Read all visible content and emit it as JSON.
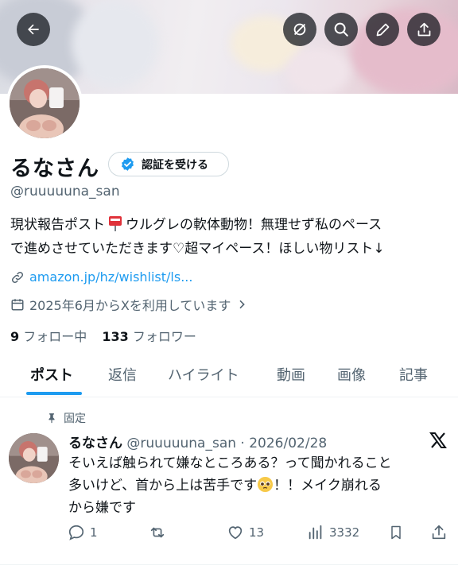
{
  "header": {
    "back_button": "back-arrow",
    "buttons": [
      "grok-icon",
      "search-icon",
      "edit-icon",
      "share-icon"
    ]
  },
  "profile": {
    "name": "るなさん",
    "verify_label": "認証を受ける",
    "handle": "@ruuuuuna_san",
    "bio_line1_pre": "現状報告ポスト",
    "bio_line1_post": "ウルグレの軟体動物！無理せず私のペース",
    "bio_line2": "で進めさせていただきます♡超マイペース！ほしい物リスト↓",
    "link_text": "amazon.jp/hz/wishlist/ls...",
    "joined_text": "2025年6月からXを利用しています",
    "following_count": "9",
    "following_label": " フォロー中",
    "followers_count": "133",
    "followers_label": " フォロワー"
  },
  "tabs": [
    "ポスト",
    "返信",
    "ハイライト",
    "動画",
    "画像",
    "記事"
  ],
  "active_tab": "ポスト",
  "pinned_post": {
    "pinned_label": "固定",
    "author_name": "るなさん",
    "meta": " @ruuuuuna_san · 2026/02/28",
    "text_line1": "そいえば触られて嫌なところある？って聞かれること",
    "text_line2_pre": "多いけど、首から上は苦手です",
    "text_line2_post": "！！メイク崩れる",
    "text_line3": "から嫌です",
    "replies": "1",
    "reposts": "",
    "likes": "13",
    "views": "3332"
  },
  "colors": {
    "accent": "#1d9bf0",
    "text_primary": "#0f1419",
    "text_secondary": "#536471",
    "border": "#cfd9de"
  }
}
